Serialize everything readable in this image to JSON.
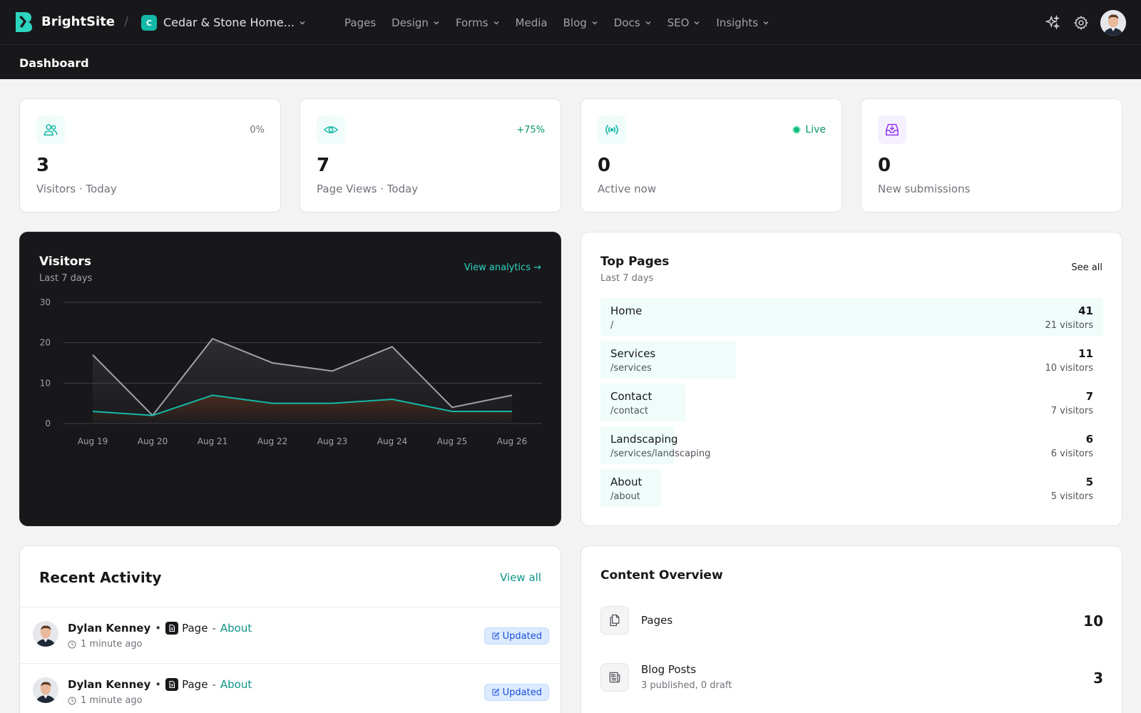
{
  "app": {
    "brand": "BrightSite",
    "site_initial": "C",
    "site_name": "Cedar & Stone Home..."
  },
  "nav": [
    {
      "label": "Pages",
      "has_menu": false
    },
    {
      "label": "Design",
      "has_menu": true
    },
    {
      "label": "Forms",
      "has_menu": true
    },
    {
      "label": "Media",
      "has_menu": false
    },
    {
      "label": "Blog",
      "has_menu": true
    },
    {
      "label": "Docs",
      "has_menu": true
    },
    {
      "label": "SEO",
      "has_menu": true
    },
    {
      "label": "Insights",
      "has_menu": true
    }
  ],
  "header_icons": [
    "sparkles-icon",
    "gear-icon",
    "user-avatar"
  ],
  "page_title": "Dashboard",
  "stats": [
    {
      "icon": "users-icon",
      "value": "3",
      "label": "Visitors · Today",
      "change": "0%",
      "accent": "#14b8a6"
    },
    {
      "icon": "eye-icon",
      "value": "7",
      "label": "Page Views · Today",
      "change": "+75%",
      "accent": "#14b8a6"
    },
    {
      "icon": "broadcast-icon",
      "value": "0",
      "label": "Active now",
      "live": "Live",
      "accent": "#14b8a6"
    },
    {
      "icon": "inbox-icon",
      "value": "0",
      "label": "New submissions",
      "accent": "#9333ea"
    }
  ],
  "visitors_chart": {
    "title": "Visitors",
    "subtitle": "Last 7 days",
    "link": "View analytics →"
  },
  "chart_data": {
    "type": "line",
    "x": [
      "Aug 19",
      "Aug 20",
      "Aug 21",
      "Aug 22",
      "Aug 23",
      "Aug 24",
      "Aug 25",
      "Aug 26"
    ],
    "series": [
      {
        "values": [
          17,
          2,
          21,
          15,
          13,
          19,
          4,
          7
        ],
        "color": "#a1a1aa"
      },
      {
        "values": [
          3,
          2,
          7,
          5,
          5,
          6,
          3,
          3
        ],
        "color": "#14b8a6"
      }
    ],
    "yticks": [
      0,
      10,
      20,
      30
    ],
    "ylim": [
      0,
      30
    ],
    "grid": true
  },
  "top_pages": {
    "title": "Top Pages",
    "subtitle": "Last 7 days",
    "see_all": "See all",
    "rows": [
      {
        "name": "Home",
        "path": "/",
        "views": "41",
        "visitors": "21 visitors",
        "share": 1.0
      },
      {
        "name": "Services",
        "path": "/services",
        "views": "11",
        "visitors": "10 visitors",
        "share": 0.27
      },
      {
        "name": "Contact",
        "path": "/contact",
        "views": "7",
        "visitors": "7 visitors",
        "share": 0.17
      },
      {
        "name": "Landscaping",
        "path": "/services/landscaping",
        "views": "6",
        "visitors": "6 visitors",
        "share": 0.146
      },
      {
        "name": "About",
        "path": "/about",
        "views": "5",
        "visitors": "5 visitors",
        "share": 0.122
      }
    ]
  },
  "activity": {
    "title": "Recent Activity",
    "view_all": "View all",
    "items": [
      {
        "user": "Dylan Kenney",
        "sep": "•",
        "type": "Page",
        "dash": "-",
        "target": "About",
        "time": "1 minute ago",
        "badge": "Updated"
      },
      {
        "user": "Dylan Kenney",
        "sep": "•",
        "type": "Page",
        "dash": "-",
        "target": "About",
        "time": "1 minute ago",
        "badge": "Updated"
      }
    ]
  },
  "content_overview": {
    "title": "Content Overview",
    "items": [
      {
        "icon": "pages-icon",
        "label": "Pages",
        "sub": "",
        "count": "10"
      },
      {
        "icon": "blog-posts-icon",
        "label": "Blog Posts",
        "sub": "3 published, 0 draft",
        "count": "3"
      }
    ]
  }
}
